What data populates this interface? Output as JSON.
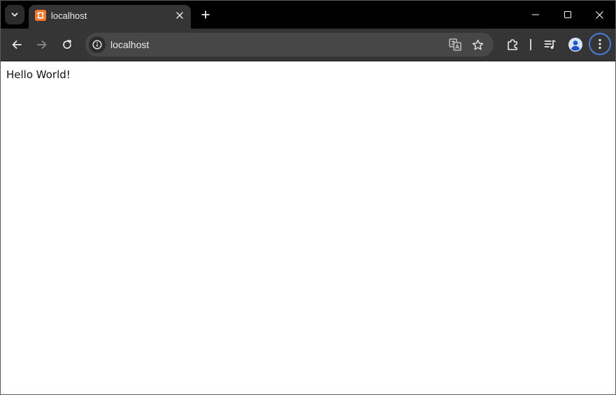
{
  "tab": {
    "title": "localhost",
    "favicon": "xampp-icon"
  },
  "address_bar": {
    "url": "localhost"
  },
  "icons": {
    "tab_search": "chevron-down-icon",
    "tab_close": "close-icon",
    "new_tab": "plus-icon",
    "back": "arrow-left-icon",
    "forward": "arrow-right-icon",
    "reload": "reload-icon",
    "site_info": "info-icon",
    "translate": "translate-icon",
    "bookmark": "star-icon",
    "extensions": "puzzle-icon",
    "media": "media-queue-icon",
    "profile": "profile-icon",
    "menu": "kebab-menu-icon",
    "minimize": "minimize-icon",
    "maximize": "maximize-icon",
    "window_close": "window-close-icon"
  },
  "colors": {
    "accent": "#4b7bd6",
    "favicon": "#f6782a",
    "titlebar": "#000000",
    "toolbar": "#353535"
  },
  "page": {
    "text": "Hello World!"
  }
}
